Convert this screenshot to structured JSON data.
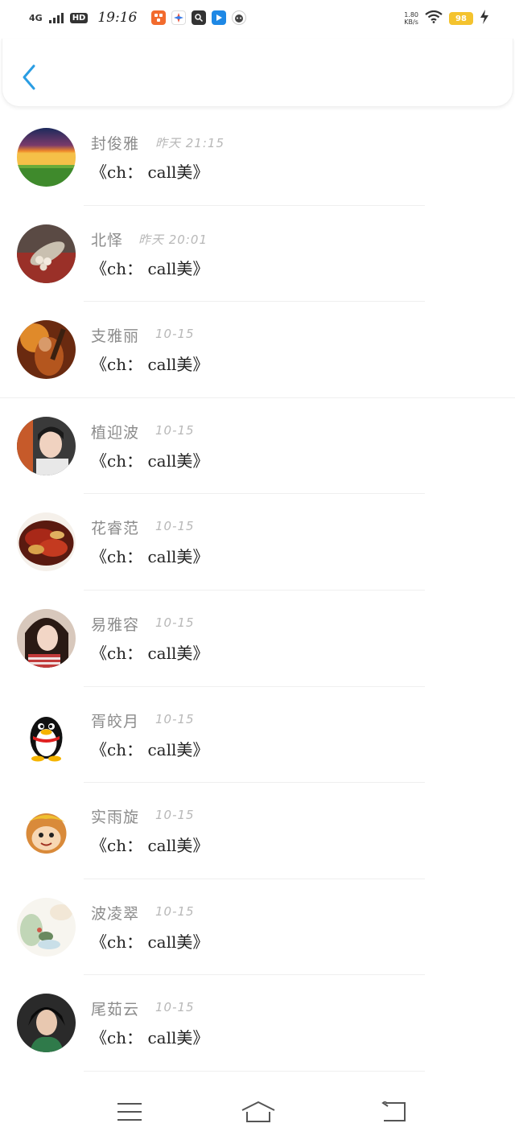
{
  "status_bar": {
    "network": "4G",
    "hd": "HD",
    "time": "19:16",
    "speed_value": "1.80",
    "speed_unit": "KB/s",
    "battery": "98",
    "apps": [
      {
        "icon": "app-icon-orange",
        "glyph": "器",
        "color": "#f26b2e"
      },
      {
        "icon": "compass-icon",
        "glyph": "✦",
        "color": "#e8503a"
      },
      {
        "icon": "search-app-icon",
        "glyph": "搜",
        "color": "#333333"
      },
      {
        "icon": "tag-app-icon",
        "glyph": "▸",
        "color": "#1e88e5"
      },
      {
        "icon": "cat-app-icon",
        "glyph": "◉",
        "color": "#444444"
      }
    ]
  },
  "header": {
    "back_icon": "chevron-left-icon",
    "accent_color": "#2a9de3"
  },
  "messages": [
    {
      "name": "封俊雅",
      "time": "昨天 21:15",
      "text": "《ch： call美》",
      "avatar": "sunset"
    },
    {
      "name": "北怿",
      "time": "昨天 20:01",
      "text": "《ch： call美》",
      "avatar": "pearl-brooch"
    },
    {
      "name": "支雅丽",
      "time": "10-15",
      "text": "《ch： call美》",
      "avatar": "warrior-art"
    },
    {
      "name": "植迎波",
      "time": "10-15",
      "text": "《ch： call美》",
      "avatar": "young-man"
    },
    {
      "name": "花睿范",
      "time": "10-15",
      "text": "《ch： call美》",
      "avatar": "chili-dish"
    },
    {
      "name": "易雅容",
      "time": "10-15",
      "text": "《ch： call美》",
      "avatar": "girl-portrait"
    },
    {
      "name": "胥皎月",
      "time": "10-15",
      "text": "《ch： call美》",
      "avatar": "qq-penguin"
    },
    {
      "name": "实雨旋",
      "time": "10-15",
      "text": "《ch： call美》",
      "avatar": "monkey-king-cartoon"
    },
    {
      "name": "波凌翠",
      "time": "10-15",
      "text": "《ch： call美》",
      "avatar": "watercolor-bird"
    },
    {
      "name": "尾茹云",
      "time": "10-15",
      "text": "《ch： call美》",
      "avatar": "man-green-scarf"
    }
  ],
  "nav_bar": {
    "menu_icon": "menu-icon",
    "home_icon": "home-icon",
    "back_icon": "return-icon"
  }
}
